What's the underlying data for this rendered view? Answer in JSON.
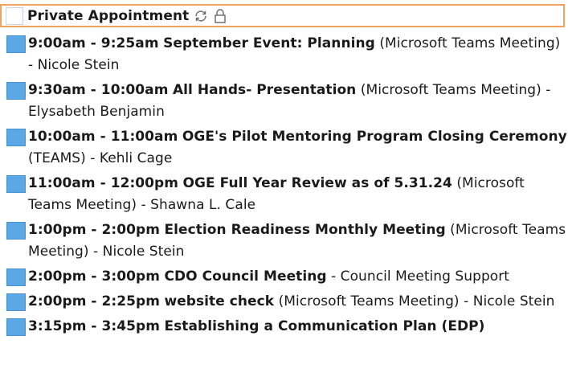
{
  "private": {
    "title": "Private Appointment",
    "icons": [
      "recurring-icon",
      "lock-icon"
    ]
  },
  "events": [
    {
      "time": "9:00am - 9:25am",
      "title": "September Event: Planning",
      "location": "(Microsoft Teams Meeting)",
      "organizer": "Nicole Stein"
    },
    {
      "time": "9:30am - 10:00am",
      "title": "All Hands- Presentation",
      "location": "(Microsoft Teams Meeting)",
      "organizer": "Elysabeth Benjamin"
    },
    {
      "time": "10:00am - 11:00am",
      "title": "OGE's Pilot Mentoring Program Closing Ceremony",
      "location": " (TEAMS)",
      "organizer": "Kehli Cage"
    },
    {
      "time": "11:00am - 12:00pm",
      "title": "OGE Full Year Review as of 5.31.24",
      "location": "(Microsoft Teams Meeting)",
      "organizer": "Shawna L. Cale"
    },
    {
      "time": "1:00pm - 2:00pm",
      "title": "Election Readiness Monthly Meeting",
      "location": "(Microsoft Teams Meeting)",
      "organizer": "Nicole Stein"
    },
    {
      "time": "2:00pm - 3:00pm",
      "title": "CDO Council Meeting",
      "location": "",
      "organizer": "Council Meeting Support"
    },
    {
      "time": "2:00pm - 2:25pm",
      "title": "website check",
      "location": "(Microsoft Teams Meeting)",
      "organizer": "Nicole Stein"
    },
    {
      "time": "3:15pm - 3:45pm",
      "title": "Establishing a Communication Plan  (EDP)",
      "location": "",
      "organizer": ""
    }
  ],
  "colors": {
    "category_blue": "#5aa9e6",
    "selection_orange": "#f4a259"
  }
}
